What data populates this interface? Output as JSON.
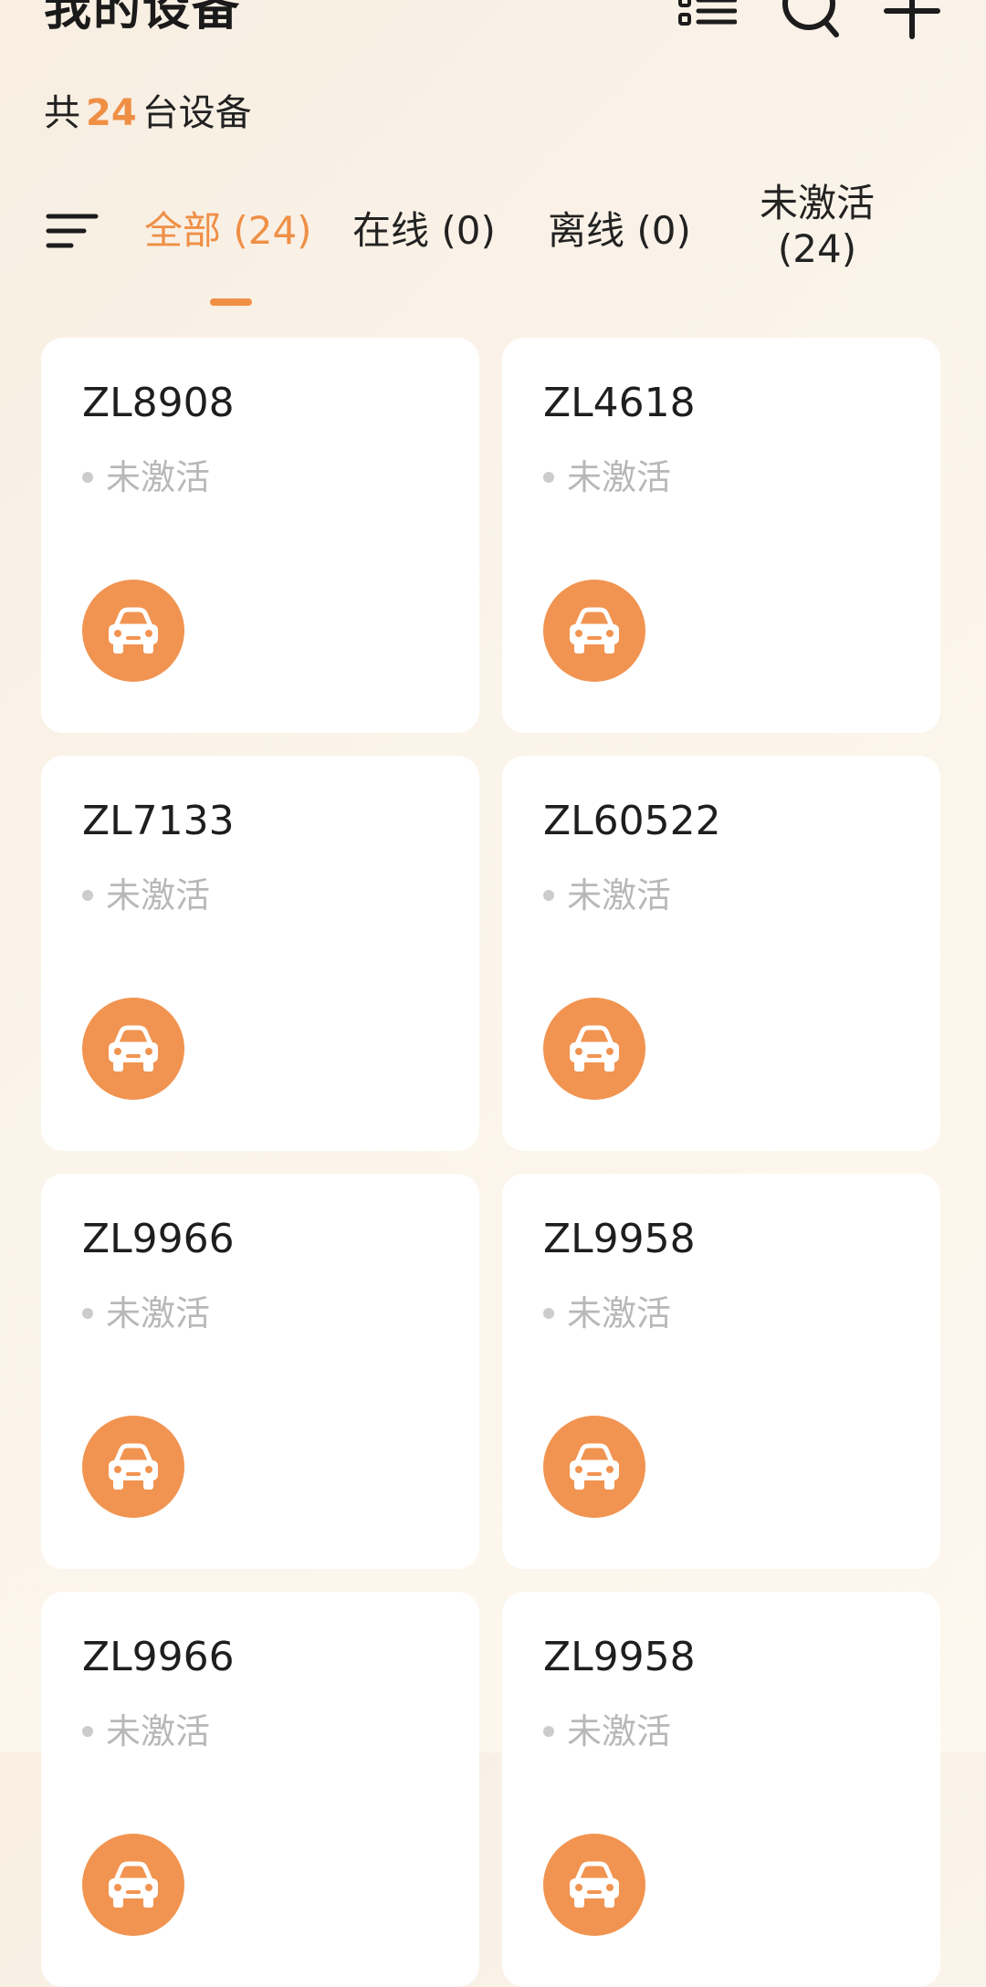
{
  "header": {
    "title": "我的设备",
    "count_prefix": "共",
    "count_value": "24",
    "count_suffix": "台设备"
  },
  "icons": {
    "list": "list-icon",
    "search": "search-icon",
    "add": "plus-icon",
    "filter": "filter-icon",
    "car": "car-icon"
  },
  "tabs": [
    {
      "label": "全部 (24)"
    },
    {
      "label": "在线 (0)"
    },
    {
      "label": "离线 (0)"
    },
    {
      "label": "未激活 (24)"
    }
  ],
  "devices": [
    {
      "name": "ZL8908",
      "status": "未激活"
    },
    {
      "name": "ZL4618",
      "status": "未激活"
    },
    {
      "name": "ZL7133",
      "status": "未激活"
    },
    {
      "name": "ZL60522",
      "status": "未激活"
    },
    {
      "name": "ZL9966",
      "status": "未激活"
    },
    {
      "name": "ZL9958",
      "status": "未激活"
    },
    {
      "name": "ZL9966",
      "status": "未激活"
    },
    {
      "name": "ZL9958",
      "status": "未激活"
    }
  ],
  "colors": {
    "accent": "#ef8f46",
    "badge": "#f19451",
    "status_inactive": "#b8b8b8"
  }
}
